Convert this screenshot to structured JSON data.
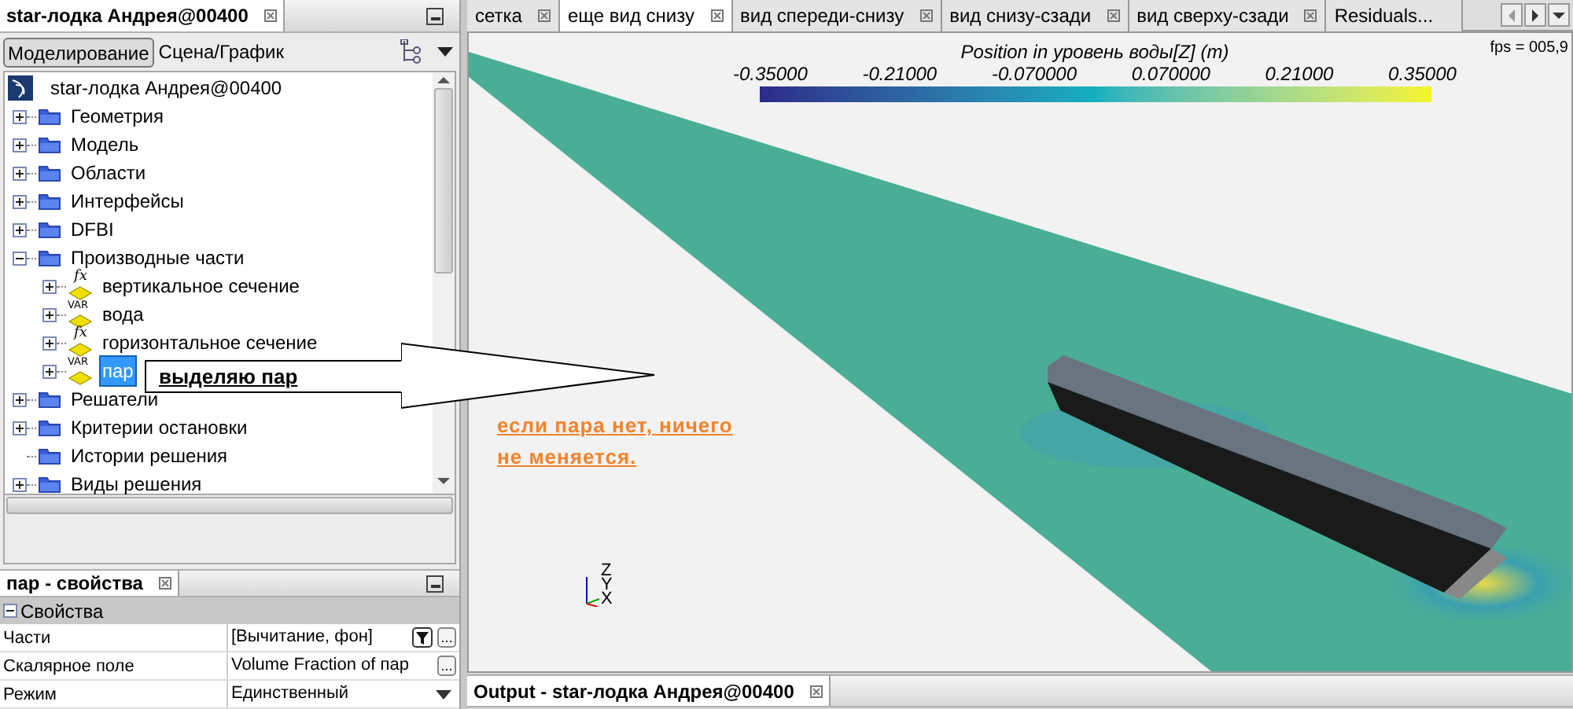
{
  "explorer": {
    "tab": "star-лодка Андрея@00400",
    "modes": [
      {
        "label": "Моделирование",
        "selected": true
      },
      {
        "label": "Сцена/График",
        "selected": false
      }
    ],
    "tree": {
      "label": "star-лодка Андрея@00400",
      "kind": "sim",
      "selected": false,
      "children": [
        {
          "label": "Геометрия",
          "kind": "folder",
          "expandable": true,
          "expanded": false,
          "selected": false
        },
        {
          "label": "Модель",
          "kind": "folder",
          "expandable": true,
          "expanded": false,
          "selected": false
        },
        {
          "label": "Области",
          "kind": "folder",
          "expandable": true,
          "expanded": false,
          "selected": false
        },
        {
          "label": "Интерфейсы",
          "kind": "folder",
          "expandable": true,
          "expanded": false,
          "selected": false
        },
        {
          "label": "DFBI",
          "kind": "folder",
          "expandable": true,
          "expanded": false,
          "selected": false
        },
        {
          "label": "Производные части",
          "kind": "folder",
          "expandable": true,
          "expanded": true,
          "selected": false,
          "children": [
            {
              "label": "вертикальное сечение",
              "kind": "fx",
              "icon_text": "fx",
              "expandable": true,
              "expanded": false,
              "selected": false
            },
            {
              "label": "вода",
              "kind": "var",
              "icon_text": "VAR",
              "expandable": true,
              "expanded": false,
              "selected": false
            },
            {
              "label": "горизонтальное сечение",
              "kind": "fx",
              "icon_text": "fx",
              "expandable": true,
              "expanded": false,
              "selected": false
            },
            {
              "label": "пар",
              "kind": "var",
              "icon_text": "VAR",
              "expandable": true,
              "expanded": false,
              "selected": true
            }
          ]
        },
        {
          "label": "Решатели",
          "kind": "folder",
          "expandable": true,
          "expanded": false,
          "selected": false
        },
        {
          "label": "Критерии остановки",
          "kind": "folder",
          "expandable": true,
          "expanded": false,
          "selected": false
        },
        {
          "label": "Истории решения",
          "kind": "folder",
          "expandable": false,
          "expanded": false,
          "selected": false
        },
        {
          "label": "Виды решения",
          "kind": "folder",
          "expandable": true,
          "expanded": false,
          "selected": false
        }
      ]
    }
  },
  "callout": {
    "text": "выделяю пар"
  },
  "properties": {
    "tab": "пар - свойства",
    "section": {
      "label": "Свойства",
      "expanded": true
    },
    "rows": [
      {
        "label": "Части",
        "value": "[Вычитание, фон]",
        "buttons": [
          {
            "kind": "filter"
          },
          {
            "kind": "ellipsis"
          }
        ]
      },
      {
        "label": "Скалярное поле",
        "value": "Volume Fraction of пар",
        "buttons": [
          {
            "kind": "ellipsis"
          }
        ]
      },
      {
        "label": "Режим",
        "value": "Единственный",
        "buttons": [
          {
            "kind": "dropdown"
          }
        ]
      }
    ]
  },
  "views": {
    "tabs": [
      {
        "label": "сетка",
        "selected": false,
        "closable": true
      },
      {
        "label": "еще вид снизу",
        "selected": true,
        "closable": true
      },
      {
        "label": "вид спереди-снизу",
        "selected": false,
        "closable": true
      },
      {
        "label": "вид снизу-сзади",
        "selected": false,
        "closable": true
      },
      {
        "label": "вид сверху-сзади",
        "selected": false,
        "closable": true
      },
      {
        "label": "Residuals...",
        "selected": false,
        "closable": false
      }
    ],
    "fps": "fps = 005,9",
    "legend": {
      "title": "Position in уровень воды[Z] (m)",
      "ticks": [
        "-0.35000",
        "-0.21000",
        "-0.070000",
        "0.070000",
        "0.21000",
        "0.35000"
      ]
    },
    "note": "если пара нет, ничего не меняется.",
    "axes": [
      "Z",
      "Y",
      "X"
    ]
  },
  "output": {
    "tab": "Output - star-лодка Андрея@00400"
  }
}
